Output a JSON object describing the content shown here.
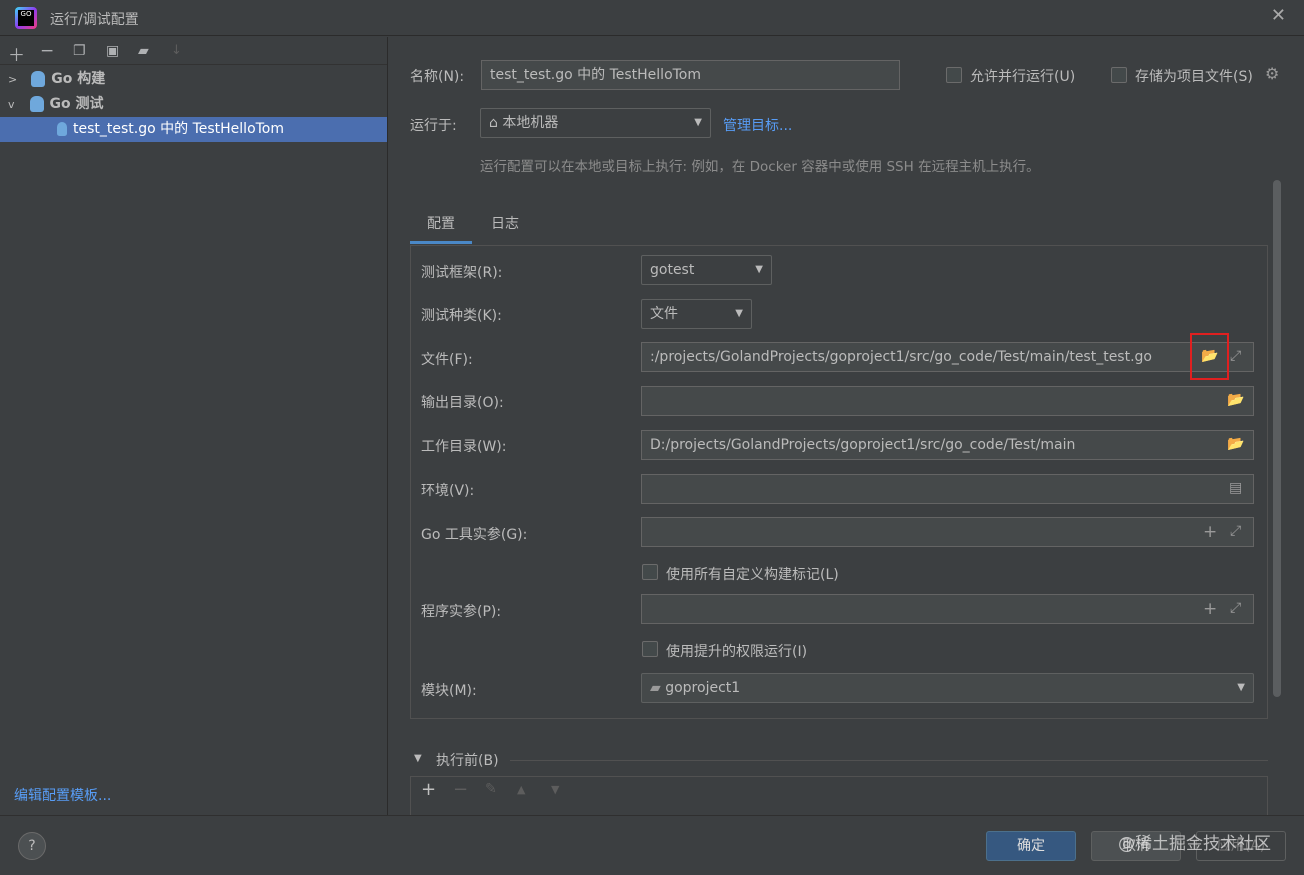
{
  "window": {
    "title": "运行/调试配置",
    "logo": "GO"
  },
  "toolbar": {
    "icons": [
      "add-icon",
      "remove-icon",
      "copy-icon",
      "save-icon",
      "new-folder-icon",
      "sort-icon"
    ]
  },
  "tree": [
    {
      "label": "Go 构建",
      "expanded": false
    },
    {
      "label": "Go 测试",
      "expanded": true
    },
    {
      "label": "test_test.go 中的 TestHelloTom",
      "selected": true
    }
  ],
  "edit_templates": "编辑配置模板...",
  "name": {
    "label": "名称(N):",
    "value": "test_test.go 中的 TestHelloTom"
  },
  "allow_parallel": {
    "label": "允许并行运行(U)",
    "checked": false
  },
  "store_project": {
    "label": "存储为项目文件(S)",
    "checked": false
  },
  "run_on": {
    "label": "运行于:",
    "value": "本地机器",
    "manage": "管理目标...",
    "hint": "运行配置可以在本地或目标上执行: 例如，在 Docker 容器中或使用 SSH 在远程主机上执行。"
  },
  "tabs": [
    {
      "label": "配置",
      "active": true
    },
    {
      "label": "日志",
      "active": false
    }
  ],
  "form": {
    "framework": {
      "label": "测试框架(R):",
      "value": "gotest"
    },
    "kind": {
      "label": "测试种类(K):",
      "value": "文件"
    },
    "file": {
      "label": "文件(F):",
      "value": ":/projects/GolandProjects/goproject1/src/go_code/Test/main/test_test.go"
    },
    "output": {
      "label": "输出目录(O):",
      "value": ""
    },
    "workdir": {
      "label": "工作目录(W):",
      "value": "D:/projects/GolandProjects/goproject1/src/go_code/Test/main"
    },
    "env": {
      "label": "环境(V):",
      "value": ""
    },
    "go_tool_args": {
      "label": "Go 工具实参(G):",
      "value": ""
    },
    "custom_tags": {
      "label": "使用所有自定义构建标记(L)",
      "checked": false
    },
    "program_args": {
      "label": "程序实参(P):",
      "value": ""
    },
    "elevated": {
      "label": "使用提升的权限运行(I)",
      "checked": false
    },
    "module": {
      "label": "模块(M):",
      "value": "goproject1"
    }
  },
  "before_launch": {
    "label": "执行前(B)"
  },
  "buttons": {
    "ok": "确定",
    "cancel": "取消",
    "apply": "应用(A)",
    "help": "?"
  },
  "watermark": "@稀土掘金技术社区",
  "highlight_color": "#e02020"
}
